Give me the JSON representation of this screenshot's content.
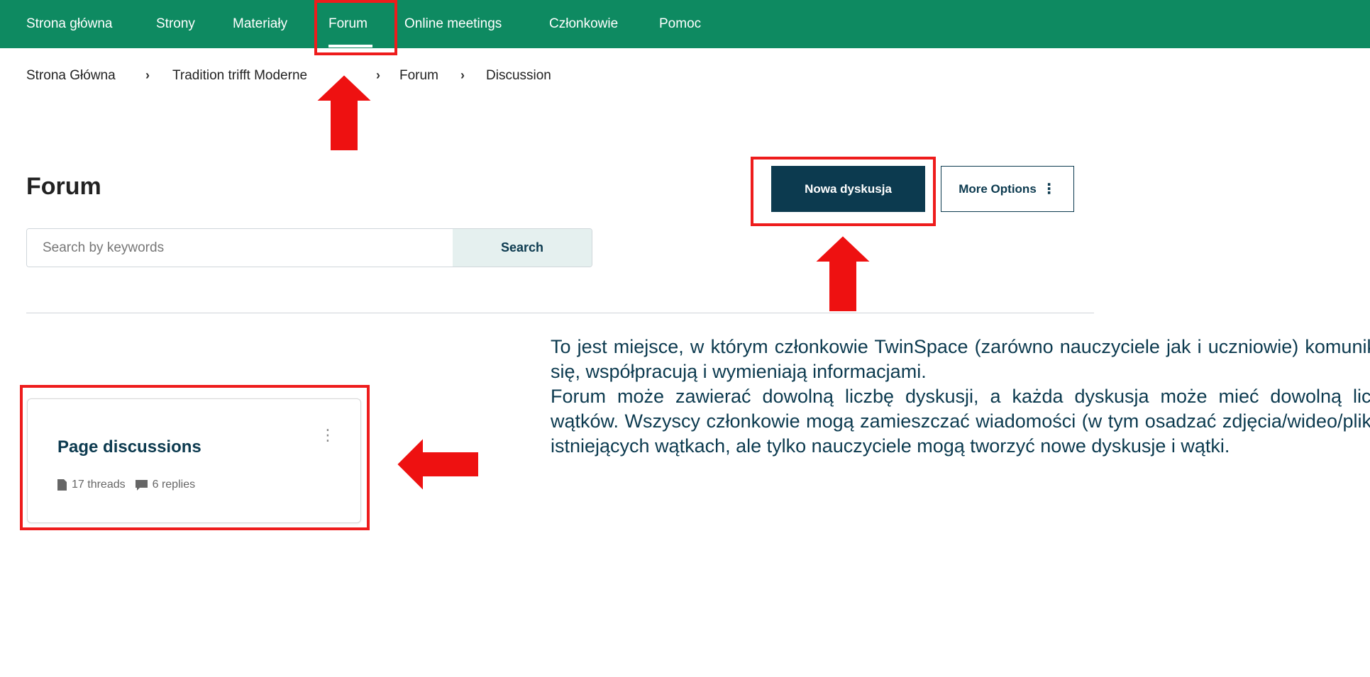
{
  "nav": {
    "items": [
      {
        "label": "Strona główna"
      },
      {
        "label": "Strony"
      },
      {
        "label": "Materiały"
      },
      {
        "label": "Forum",
        "active": true
      },
      {
        "label": "Online meetings"
      },
      {
        "label": "Członkowie"
      },
      {
        "label": "Pomoc"
      }
    ]
  },
  "breadcrumb": {
    "items": [
      "Strona Główna",
      "Tradition trifft Moderne",
      "Forum",
      "Discussion"
    ],
    "separator": "›"
  },
  "page": {
    "title": "Forum",
    "new_discussion_label": "Nowa dyskusja",
    "more_options_label": "More Options",
    "more_options_icon": "⋮"
  },
  "search": {
    "placeholder": "Search by keywords",
    "button_label": "Search"
  },
  "card": {
    "title": "Page discussions",
    "menu_icon": "⋮",
    "threads": "17 threads",
    "replies": "6 replies"
  },
  "description": {
    "paragraph1": "To jest miejsce, w którym członkowie TwinSpace (zarówno nauczyciele jak i uczniowie) komunikują się, współpracują i wymieniają informacjami.",
    "paragraph2": "Forum może zawierać dowolną liczbę dyskusji, a każda dyskusja może mieć dowolną liczbę wątków. Wszyscy członkowie mogą zamieszczać wiadomości (w tym osadzać zdjęcia/wideo/pliki) w istniejących wątkach, ale tylko nauczyciele mogą tworzyć nowe dyskusje i wątki."
  },
  "colors": {
    "nav_bg": "#0e8a61",
    "primary": "#0c3a4f",
    "highlight": "#ee1c1c",
    "arrow_fill": "#ee1111"
  }
}
